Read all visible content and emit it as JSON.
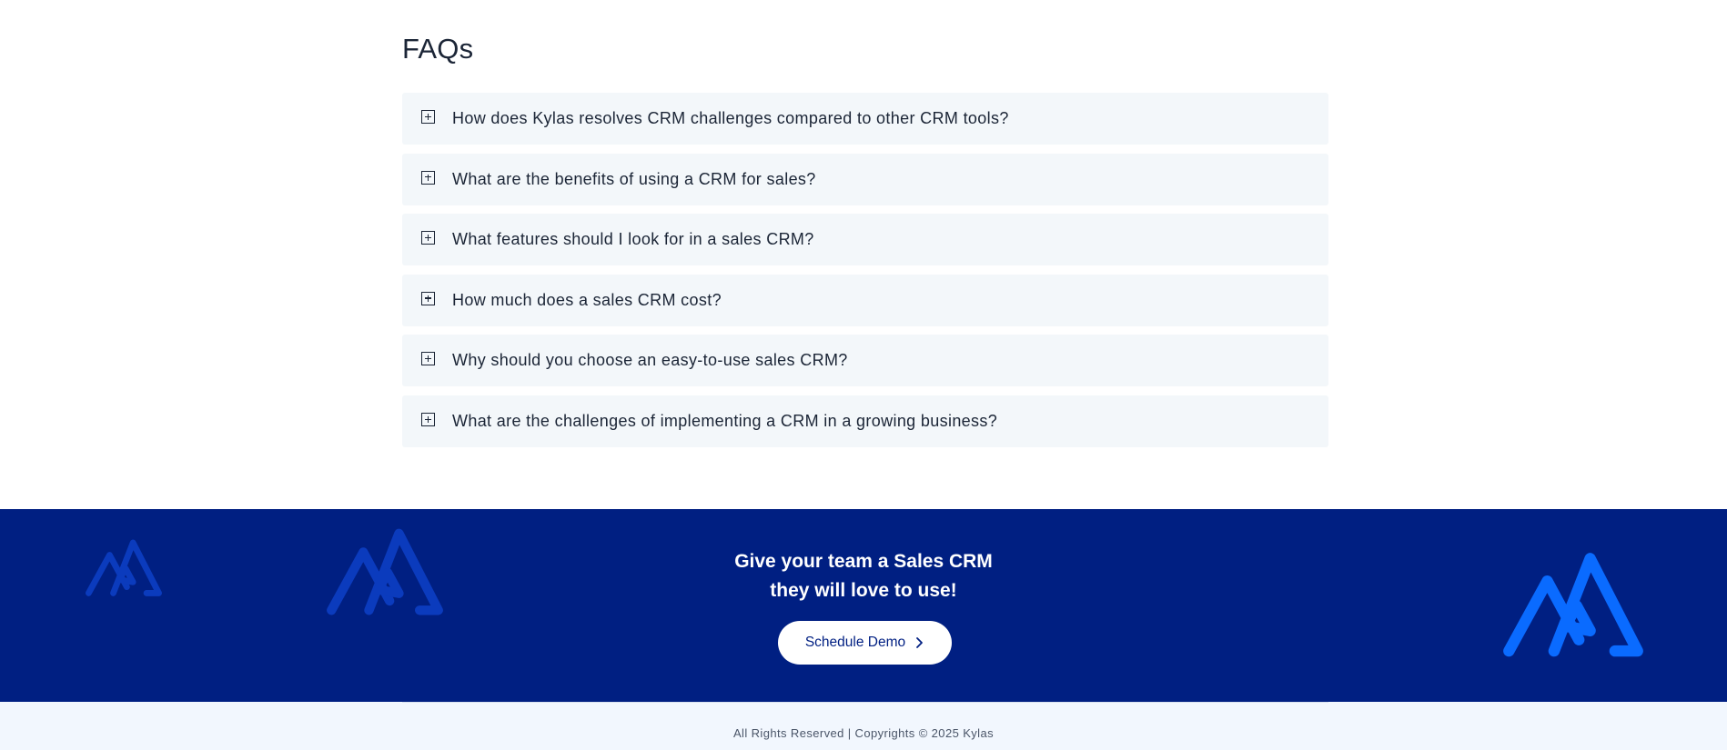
{
  "faq": {
    "title": "FAQs",
    "questions": [
      "How does Kylas resolves CRM challenges compared to other CRM tools?",
      "What are the benefits of using a CRM for sales?",
      "What features should I look for in a sales CRM?",
      "How much does a sales CRM cost?",
      "Why should you choose an easy-to-use sales CRM?",
      "What are the challenges of implementing a CRM in a growing business?"
    ]
  },
  "cta": {
    "title_line1": "Give your team a Sales CRM",
    "title_line2": "they will love to use!",
    "button_label": "Schedule Demo",
    "background_color": "#001f82",
    "logo_faint_color": "#0b3bbd",
    "logo_bright_color": "#0a6bff"
  },
  "footer": {
    "copyright": "All Rights Reserved | Copyrights © 2025 Kylas"
  },
  "icons": {
    "faq_expand": "plus-square-icon",
    "button_chevron": "chevron-right-icon",
    "logo": "kylas-logo-icon"
  }
}
